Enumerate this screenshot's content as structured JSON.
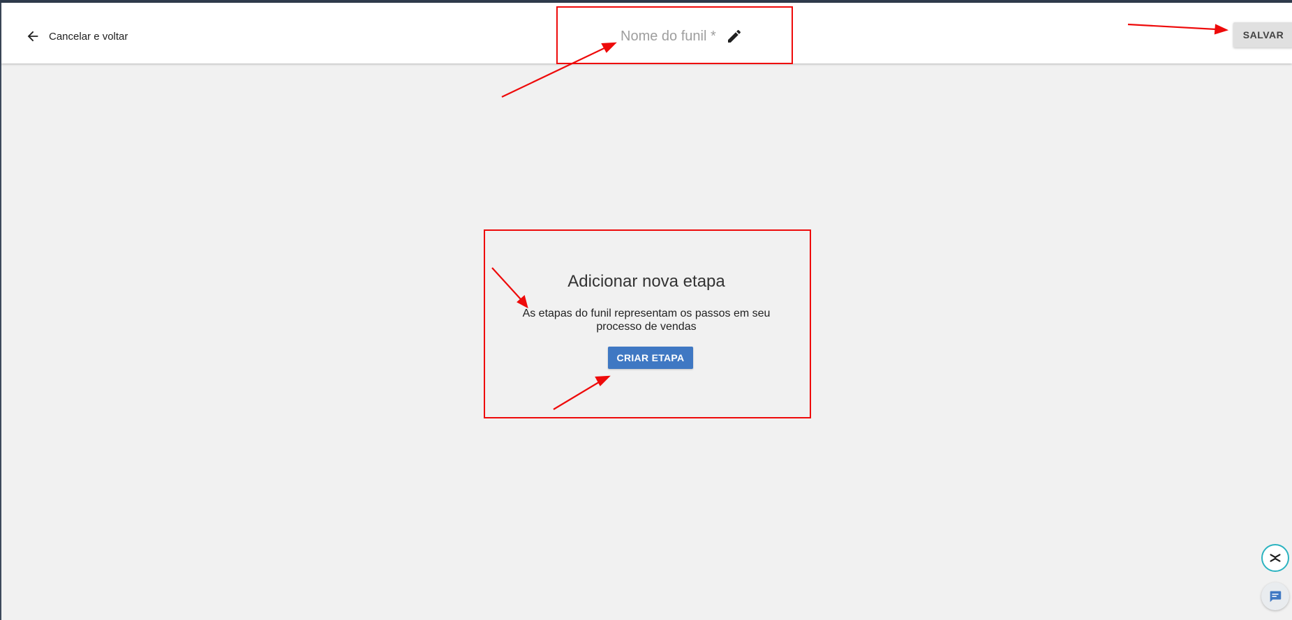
{
  "header": {
    "back_label": "Cancelar e voltar",
    "back_icon": "arrow-left-icon",
    "funnel_name_placeholder": "Nome do funil *",
    "edit_icon": "pencil-icon",
    "save_label": "SALVAR"
  },
  "empty_state": {
    "title": "Adicionar nova etapa",
    "description": "As etapas do funil representam os passos em seu processo de vendas",
    "create_label": "CRIAR ETAPA"
  },
  "floating_buttons": [
    {
      "icon": "close-chevrons-icon"
    },
    {
      "icon": "chat-icon"
    }
  ],
  "colors": {
    "primary": "#3f78c3",
    "annotation": "#ee0a0a",
    "background": "#f1f1f1",
    "fab_accent": "#2bb3c0"
  }
}
